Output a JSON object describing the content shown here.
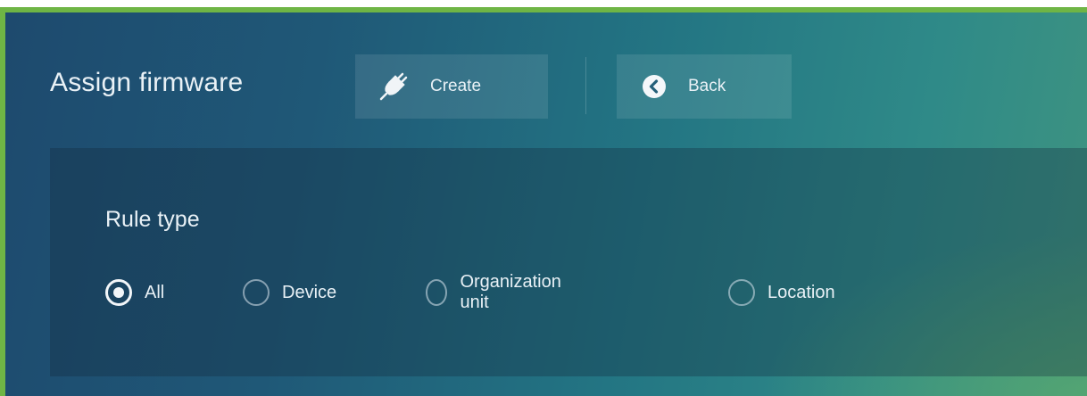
{
  "header": {
    "title": "Assign firmware",
    "buttons": [
      {
        "label": "Create",
        "icon": "plug-icon"
      },
      {
        "label": "Back",
        "icon": "chevron-left-circle-icon"
      }
    ]
  },
  "rule_type": {
    "label": "Rule type",
    "options": [
      {
        "label": "All",
        "checked": true
      },
      {
        "label": "Device",
        "checked": false
      },
      {
        "label": "Organization unit",
        "checked": false
      },
      {
        "label": "Location",
        "checked": false
      }
    ]
  },
  "colors": {
    "frame_border": "#6fb545",
    "background_start": "#1e4a6e",
    "background_end": "#3f9480",
    "text": "#e9f1f6"
  }
}
